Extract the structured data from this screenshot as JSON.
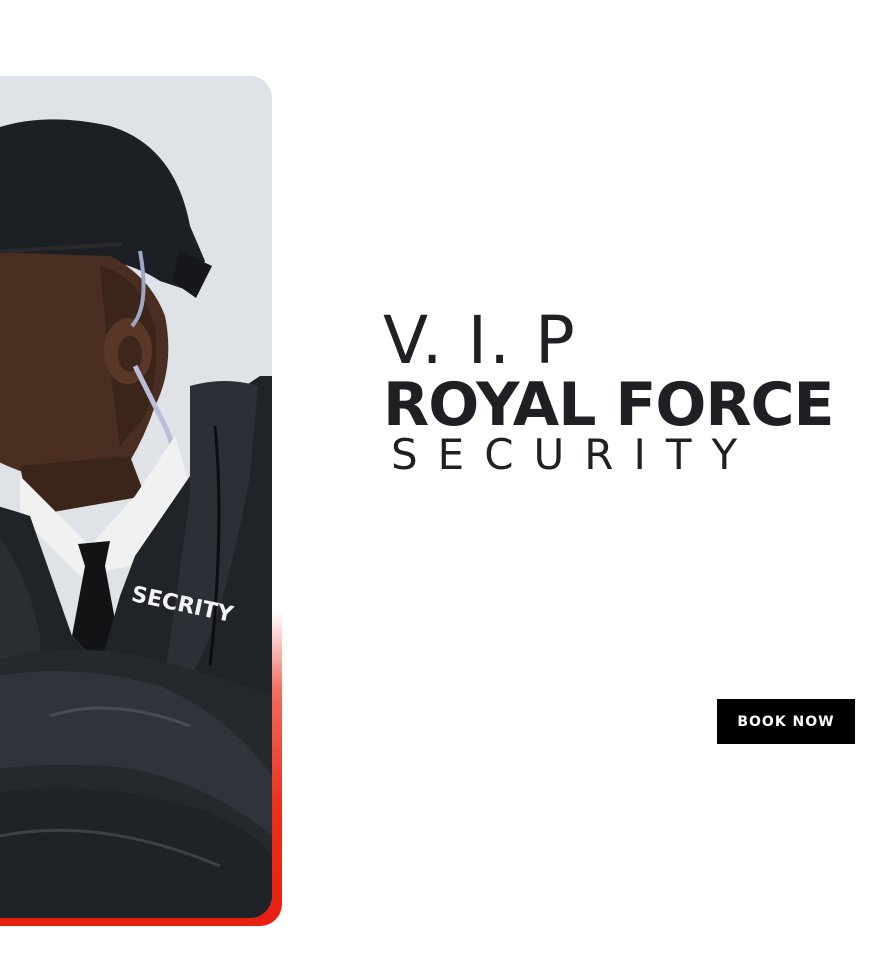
{
  "hero": {
    "line1": "V. I. P",
    "line2": "ROYAL FORCE",
    "line3": "SECURITY",
    "cta_label": "BOOK NOW",
    "jacket_text": "SECRITY"
  },
  "colors": {
    "accent": "#e81f10",
    "heading": "#1f2024",
    "button_bg": "#000000",
    "button_text": "#ffffff"
  }
}
